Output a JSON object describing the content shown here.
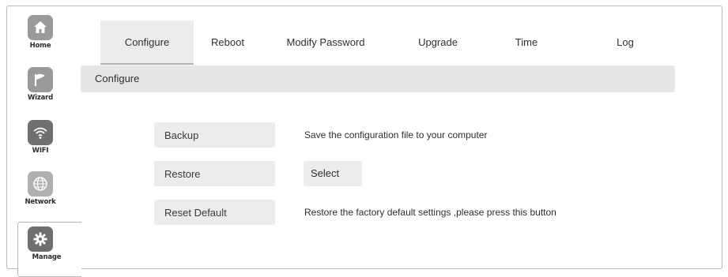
{
  "sidebar": {
    "items": [
      {
        "label": "Home",
        "icon": "home-icon"
      },
      {
        "label": "Wizard",
        "icon": "flag-icon"
      },
      {
        "label": "WIFI",
        "icon": "wifi-icon"
      },
      {
        "label": "Network",
        "icon": "globe-icon"
      },
      {
        "label": "Manage",
        "icon": "gear-icon"
      }
    ],
    "active": "Manage",
    "icon_bg": "#9a9a9a",
    "icon_bg_dark": "#6f6f6f"
  },
  "tabs": [
    "Configure",
    "Reboot",
    "Modify Password",
    "Upgrade",
    "Time",
    "Log"
  ],
  "active_tab": "Configure",
  "section": {
    "title": "Configure"
  },
  "rows": [
    {
      "button": "Backup",
      "description": "Save the configuration file to your computer"
    },
    {
      "button": "Restore",
      "action": "Select"
    },
    {
      "button": "Reset Default",
      "description": "Restore the factory default settings ,please press this button"
    }
  ]
}
